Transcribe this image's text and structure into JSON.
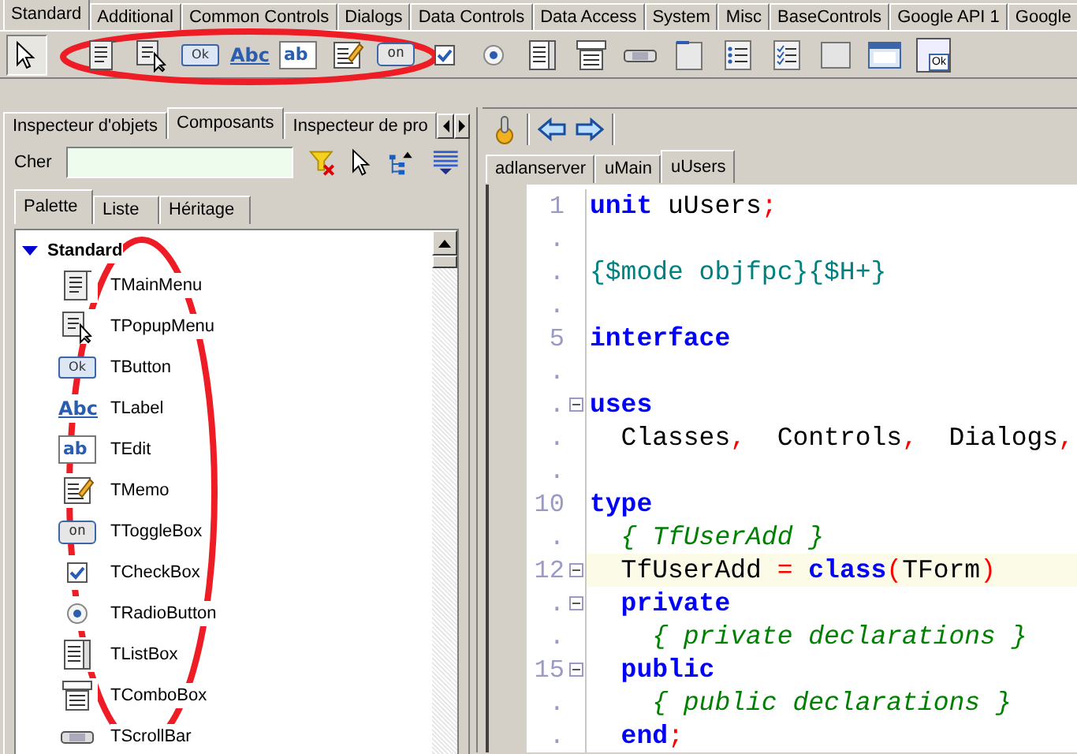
{
  "palette_tabs": [
    {
      "label": "Standard",
      "selected": true
    },
    {
      "label": "Additional",
      "selected": false
    },
    {
      "label": "Common Controls",
      "selected": false
    },
    {
      "label": "Dialogs",
      "selected": false
    },
    {
      "label": "Data Controls",
      "selected": false
    },
    {
      "label": "Data Access",
      "selected": false
    },
    {
      "label": "System",
      "selected": false
    },
    {
      "label": "Misc",
      "selected": false
    },
    {
      "label": "BaseControls",
      "selected": false
    },
    {
      "label": "Google API 1",
      "selected": false
    },
    {
      "label": "Google",
      "selected": false
    }
  ],
  "palette_toolbar": {
    "selector_pressed": true,
    "items": [
      {
        "kind": "mainmenu"
      },
      {
        "kind": "popupmenu"
      },
      {
        "kind": "button",
        "glyph": "Ok"
      },
      {
        "kind": "label",
        "glyph": "Abc"
      },
      {
        "kind": "edit",
        "glyph": "ab"
      },
      {
        "kind": "memo"
      },
      {
        "kind": "toggle",
        "glyph": "on"
      },
      {
        "kind": "checkbox"
      },
      {
        "kind": "radio"
      },
      {
        "kind": "listbox"
      },
      {
        "kind": "combobox"
      },
      {
        "kind": "scrollbar"
      },
      {
        "kind": "groupbox"
      },
      {
        "kind": "radiogroup"
      },
      {
        "kind": "checkgroup"
      },
      {
        "kind": "panel"
      },
      {
        "kind": "frame"
      },
      {
        "kind": "actionlist",
        "glyph": "Ok"
      }
    ]
  },
  "left_panel": {
    "tabs": [
      {
        "label": "Inspecteur d'objets",
        "selected": false
      },
      {
        "label": "Composants",
        "selected": true
      },
      {
        "label": "Inspecteur de pro",
        "selected": false
      }
    ],
    "search": {
      "label": "Cher"
    },
    "sub_tabs": [
      {
        "label": "Palette",
        "selected": true
      },
      {
        "label": "Liste",
        "selected": false
      },
      {
        "label": "Héritage",
        "selected": false
      }
    ],
    "group": {
      "label": "Standard",
      "expanded": true
    },
    "components": [
      {
        "name": "TMainMenu",
        "kind": "mainmenu"
      },
      {
        "name": "TPopupMenu",
        "kind": "popupmenu"
      },
      {
        "name": "TButton",
        "kind": "button",
        "glyph": "Ok"
      },
      {
        "name": "TLabel",
        "kind": "label",
        "glyph": "Abc"
      },
      {
        "name": "TEdit",
        "kind": "edit",
        "glyph": "ab"
      },
      {
        "name": "TMemo",
        "kind": "memo"
      },
      {
        "name": "TToggleBox",
        "kind": "toggle",
        "glyph": "on"
      },
      {
        "name": "TCheckBox",
        "kind": "checkbox"
      },
      {
        "name": "TRadioButton",
        "kind": "radio"
      },
      {
        "name": "TListBox",
        "kind": "listbox"
      },
      {
        "name": "TComboBox",
        "kind": "combobox"
      },
      {
        "name": "TScrollBar",
        "kind": "scrollbar"
      }
    ]
  },
  "editor": {
    "tabs": [
      {
        "label": "adlanserver",
        "selected": false
      },
      {
        "label": "uMain",
        "selected": false
      },
      {
        "label": "uUsers",
        "selected": true
      }
    ],
    "lines": [
      {
        "number": "1",
        "tokens": [
          {
            "kind": "keyword",
            "text": "unit"
          },
          {
            "kind": "plain",
            "text": " uUsers"
          },
          {
            "kind": "symbol",
            "text": ";"
          }
        ]
      },
      {
        "number": "."
      },
      {
        "number": ".",
        "tokens": [
          {
            "kind": "directive",
            "text": "{$mode objfpc}{$H+}"
          }
        ]
      },
      {
        "number": "."
      },
      {
        "number": "5",
        "tokens": [
          {
            "kind": "keyword",
            "text": "interface"
          }
        ]
      },
      {
        "number": "."
      },
      {
        "number": ".",
        "fold": true,
        "tokens": [
          {
            "kind": "keyword",
            "text": "uses"
          }
        ]
      },
      {
        "number": ".",
        "tokens": [
          {
            "kind": "plain",
            "text": "  Classes"
          },
          {
            "kind": "symbol",
            "text": ","
          },
          {
            "kind": "plain",
            "text": "  Controls"
          },
          {
            "kind": "symbol",
            "text": ","
          },
          {
            "kind": "plain",
            "text": "  Dialogs"
          },
          {
            "kind": "symbol",
            "text": ","
          }
        ]
      },
      {
        "number": "."
      },
      {
        "number": "10",
        "tokens": [
          {
            "kind": "keyword",
            "text": "type"
          }
        ]
      },
      {
        "number": ".",
        "tokens": [
          {
            "kind": "comment",
            "text": "  { TfUserAdd }"
          }
        ]
      },
      {
        "number": "12",
        "fold": true,
        "current": true,
        "tokens": [
          {
            "kind": "plain",
            "text": "  TfUserAdd "
          },
          {
            "kind": "symbol",
            "text": "= "
          },
          {
            "kind": "keyword",
            "text": "class"
          },
          {
            "kind": "symbol",
            "text": "("
          },
          {
            "kind": "plain",
            "text": "TForm"
          },
          {
            "kind": "symbol",
            "text": ")"
          }
        ]
      },
      {
        "number": ".",
        "fold": true,
        "tokens": [
          {
            "kind": "keyword",
            "text": "  private"
          }
        ]
      },
      {
        "number": ".",
        "tokens": [
          {
            "kind": "comment",
            "text": "    { private declarations }"
          }
        ]
      },
      {
        "number": "15",
        "fold": true,
        "tokens": [
          {
            "kind": "keyword",
            "text": "  public"
          }
        ]
      },
      {
        "number": ".",
        "tokens": [
          {
            "kind": "comment",
            "text": "    { public declarations }"
          }
        ]
      },
      {
        "number": ".",
        "tokens": [
          {
            "kind": "keyword",
            "text": "  end"
          },
          {
            "kind": "symbol",
            "text": ";"
          }
        ]
      }
    ]
  }
}
